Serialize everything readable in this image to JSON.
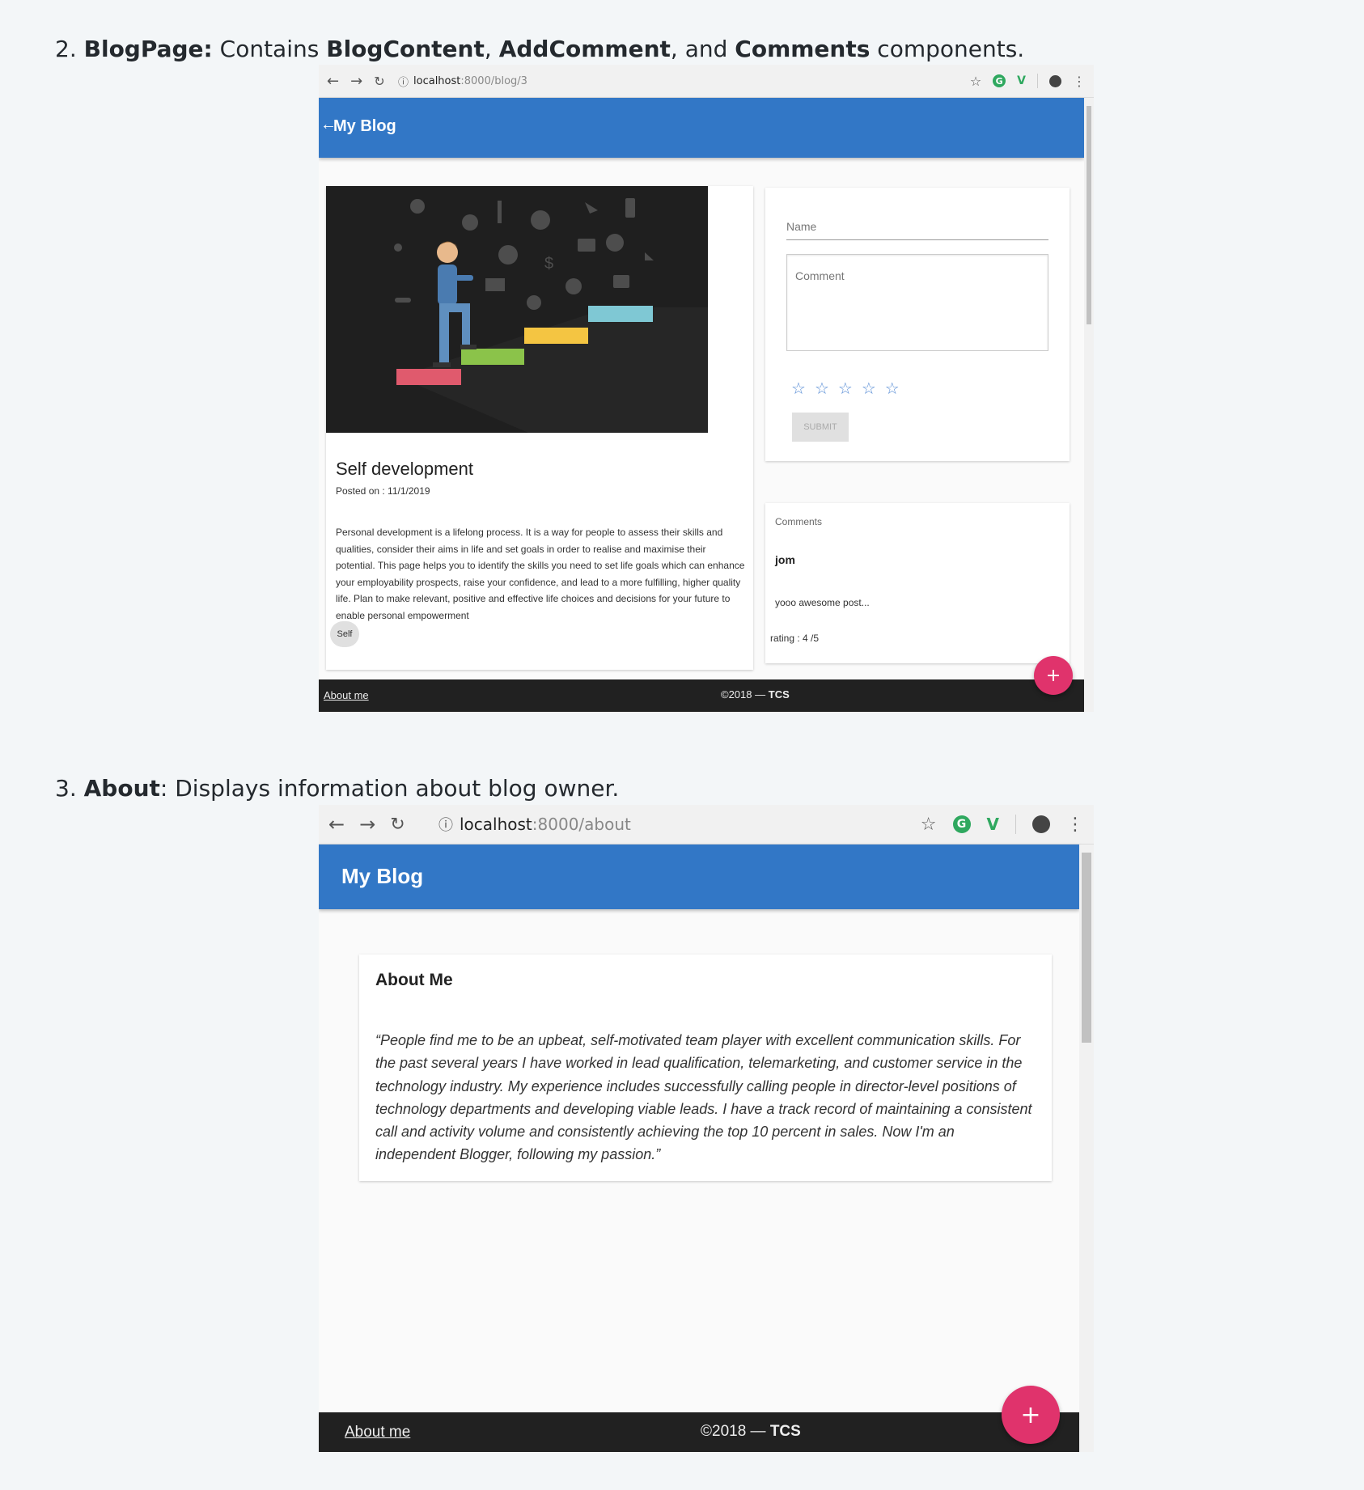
{
  "section2": {
    "number": "2.",
    "component": "BlogPage:",
    "text_a": " Contains ",
    "c1": "BlogContent",
    "comma": ", ",
    "c2": "AddComment",
    "text_b": ", and ",
    "c3": "Comments",
    "text_c": " components."
  },
  "section3": {
    "number": "3.",
    "component": "About",
    "text": ": Displays information about blog owner."
  },
  "browser1": {
    "url_host": "localhost",
    "url_path": ":8000/blog/3",
    "appbar_title": "My Blog",
    "blog": {
      "title": "Self development",
      "posted": "Posted on : 11/1/2019",
      "body": "Personal development is a lifelong process. It is a way for people to assess their skills and qualities, consider their aims in life and set goals in order to realise and maximise their potential. This page helps you to identify the skills you need to set life goals which can enhance your employability prospects, raise your confidence, and lead to a more fulfilling, higher quality life. Plan to make relevant, positive and effective life choices and decisions for your future to enable personal empowerment",
      "chip": "Self"
    },
    "add_comment": {
      "name_placeholder": "Name",
      "comment_placeholder": "Comment",
      "rating_stars": 5,
      "submit_label": "SUBMIT"
    },
    "comments": {
      "heading": "Comments",
      "author": "jom",
      "text": "yooo awesome post...",
      "rating": "rating : 4 /5"
    },
    "footer": {
      "about_link": "About me",
      "copyright": "©2018 —",
      "company": "TCS"
    },
    "fab_label": "+"
  },
  "browser2": {
    "url_host": "localhost",
    "url_path": ":8000/about",
    "appbar_title": "My Blog",
    "about": {
      "heading": "About Me",
      "quote": "“People find me to be an upbeat, self-motivated team player with excellent communication skills. For the past several years I have worked in lead qualification, telemarketing, and customer service in the technology industry. My experience includes successfully calling people in director-level positions of technology departments and developing viable leads. I have a track record of maintaining a consistent call and activity volume and consistently achieving the top 10 percent in sales. Now I'm an independent Blogger, following my passion.”"
    },
    "footer": {
      "about_link": "About me",
      "copyright": "©2018 —",
      "company": "TCS"
    },
    "fab_label": "+"
  },
  "icons": {
    "back": "←",
    "forward": "→",
    "reload": "↻",
    "info": "ⓘ",
    "star": "☆",
    "menu": "⋮",
    "account": "●"
  },
  "colors": {
    "appbar": "#3277c6",
    "footer": "#212121",
    "fab": "#e0336c",
    "star": "#5b8fd6"
  }
}
